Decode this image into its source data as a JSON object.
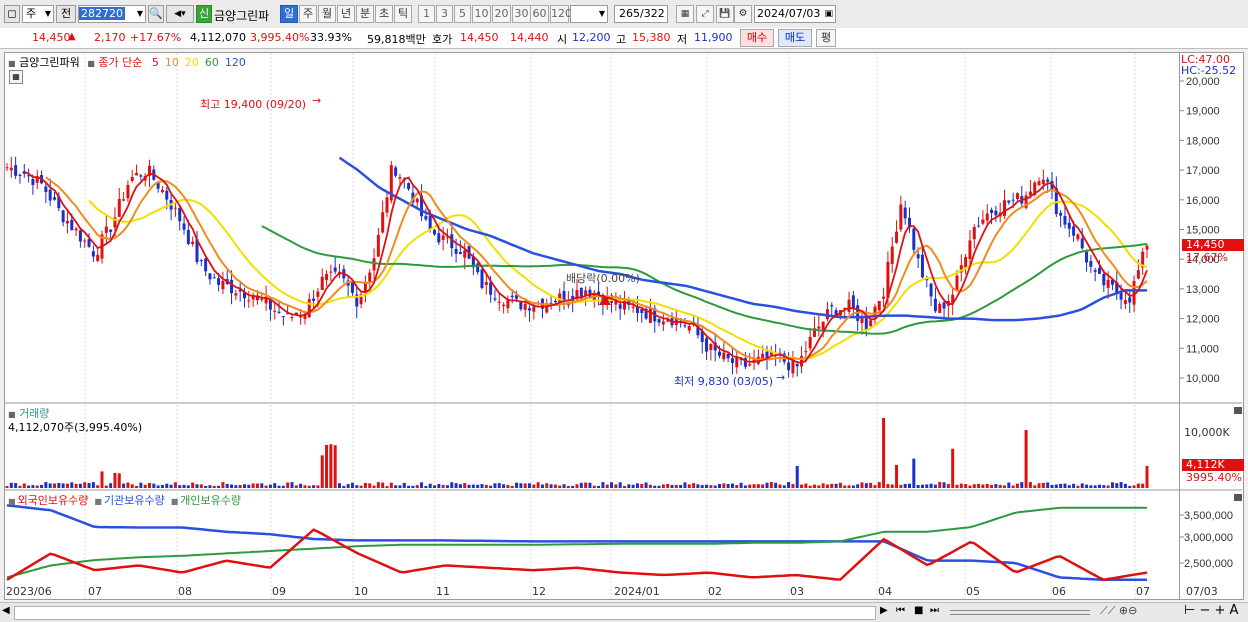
{
  "toolbar": {
    "mode": "주",
    "type": "전",
    "code": "282720",
    "stock_name": "금양그린파",
    "new_badge": "신",
    "periods": [
      "일",
      "주",
      "월",
      "년",
      "분",
      "초",
      "틱"
    ],
    "active_period": "일",
    "intervals": [
      "1",
      "3",
      "5",
      "10",
      "20",
      "30",
      "60",
      "120"
    ],
    "count": "265",
    "total": "/322",
    "date": "2024/07/03"
  },
  "quote": {
    "price": "14,450",
    "change": "2,170",
    "change_pct": "+17.67%",
    "volume": "4,112,070",
    "volume_pct": "3,995.40%",
    "turnover": "33.93%",
    "amount": "59,818백만",
    "bid_label": "호가",
    "bid_price": "14,450",
    "ask_price": "14,440",
    "open_label": "시",
    "open": "12,200",
    "high_label": "고",
    "high": "15,380",
    "low_label": "저",
    "low": "11,900",
    "buy_btn": "매수",
    "sell_btn": "매도",
    "avg_btn": "평"
  },
  "price_panel": {
    "name": "금양그린파워",
    "ma_label": "종가 단순",
    "ma_periods": [
      "5",
      "10",
      "20",
      "60",
      "120"
    ],
    "ma_colors": [
      "#e01010",
      "#f08c1e",
      "#f0e000",
      "#2e9a3e",
      "#2a50e0"
    ],
    "lc": "LC:47.00",
    "hc": "HC:-25.52",
    "y_ticks": [
      "20,000",
      "19,000",
      "18,000",
      "17,000",
      "16,000",
      "15,000",
      "14,000",
      "13,000",
      "12,000",
      "11,000",
      "10,000"
    ],
    "high_note": "최고 19,400 (09/20)",
    "low_note": "최저 9,830 (03/05)",
    "dividend_note": "배당락(0.00%)",
    "last_price_tag": "14,450",
    "last_pct_tag": "17.67%"
  },
  "volume_panel": {
    "title": "거래량",
    "value": "4,112,070주(3,995.40%)",
    "y_tick": "10,000K",
    "last_tag": "4,112K",
    "last_pct": "3995.40%"
  },
  "holding_panel": {
    "series_labels": [
      "외국인보유수량",
      "기관보유수량",
      "개인보유수량"
    ],
    "series_colors": [
      "#e01010",
      "#2a50e0",
      "#2e9a3e"
    ],
    "y_ticks": [
      "3,500,000",
      "3,000,000",
      "2,500,000"
    ]
  },
  "x_axis": {
    "labels": [
      "2023/06",
      "07",
      "08",
      "09",
      "10",
      "11",
      "12",
      "2024/01",
      "02",
      "03",
      "04",
      "05",
      "06",
      "07"
    ],
    "right_label": "07/03"
  },
  "chart_data": {
    "type": "line",
    "note_price_range": [
      9830,
      19400
    ],
    "series": [
      {
        "name": "5",
        "values": [
          17100,
          16900,
          16500,
          15600,
          14900,
          14200,
          15200,
          16700,
          17000,
          16200,
          15200,
          13800,
          13200,
          13000,
          12800,
          12400,
          12000,
          12300,
          13300,
          13400,
          12600,
          14200,
          17200,
          16300,
          15000,
          14600,
          14300,
          13200,
          12800,
          12500,
          12500,
          12600,
          12800,
          13000,
          12700,
          12400,
          12300,
          12100,
          12000,
          11700,
          11000,
          10600,
          10400,
          10600,
          10700,
          10300,
          11500,
          12300,
          12400,
          11800,
          13000,
          16000,
          13800,
          12200,
          12900,
          15000,
          15600,
          15900,
          16100,
          17000,
          15500,
          14800,
          13400,
          13000,
          12700,
          14450
        ]
      },
      {
        "name": "120",
        "values": [
          null,
          null,
          null,
          null,
          null,
          null,
          null,
          null,
          null,
          null,
          null,
          null,
          null,
          null,
          null,
          17500,
          17000,
          16400,
          16000,
          15600,
          15300,
          15000,
          14800,
          14500,
          14200,
          14000,
          13800,
          13600,
          13500,
          13300,
          13200,
          13100,
          12900,
          12700,
          12500,
          12400,
          12250,
          12150,
          12050,
          12050,
          12100,
          12100,
          12050,
          12000,
          12000,
          11950,
          11950,
          12000,
          12100,
          12300,
          12700,
          12950,
          12950
        ]
      }
    ]
  }
}
